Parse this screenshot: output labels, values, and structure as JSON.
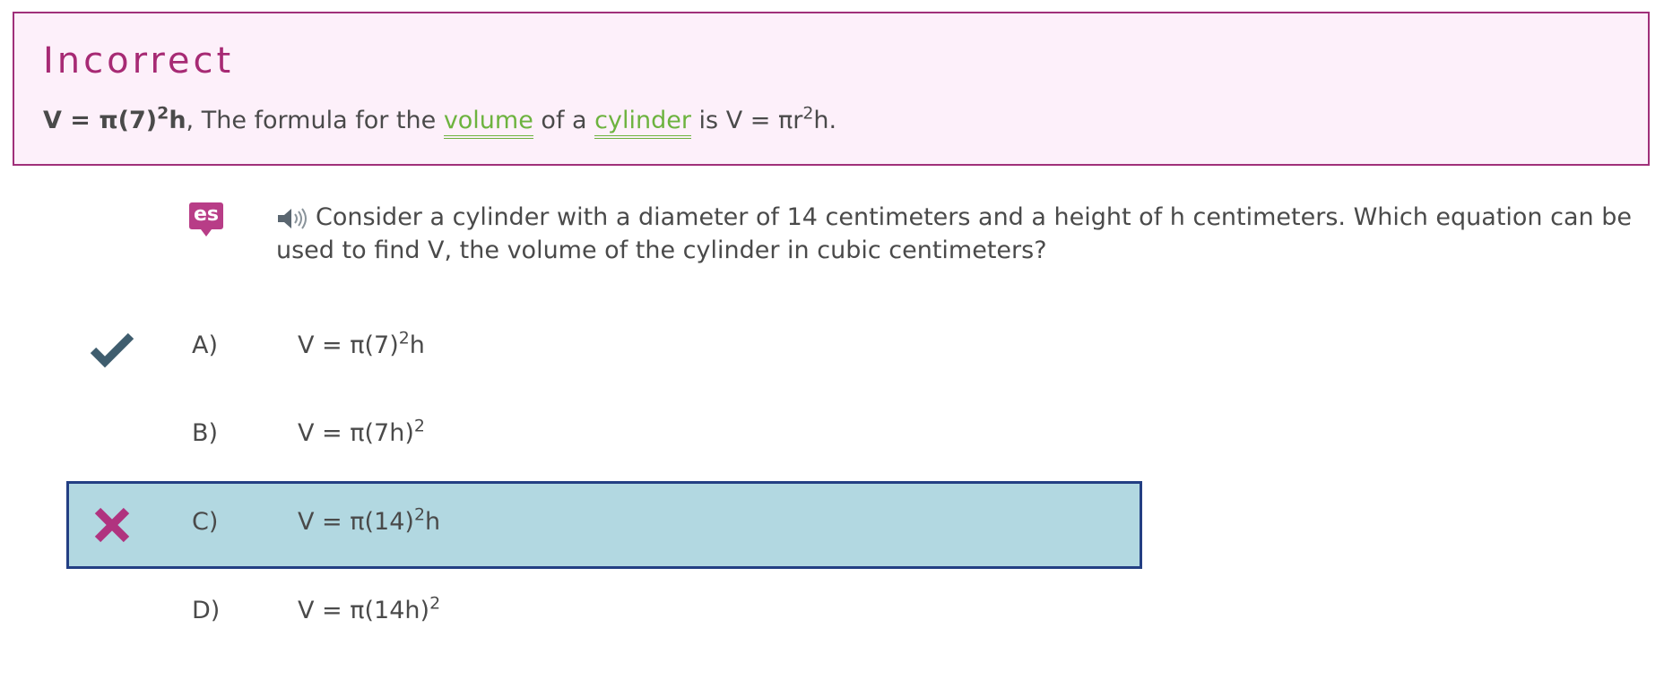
{
  "feedback": {
    "title": "Incorrect",
    "correct_answer": {
      "base": "V = π(7)",
      "exp": "2",
      "tail": "h"
    },
    "explanation_prefix": ", The formula for the ",
    "term_volume": "volume",
    "text_of_a": " of a ",
    "term_cylinder": "cylinder",
    "formula_prefix": " is V = πr",
    "formula_exp": "2",
    "formula_suffix": "h."
  },
  "question": {
    "language_icon_label": "es",
    "speaker_icon": "speaker-icon",
    "text": "Consider a cylinder with a diameter of 14 centimeters and a height of h centimeters. Which equation can be used to find V, the volume of the cylinder in cubic centimeters?"
  },
  "choices": [
    {
      "letter": "A)",
      "base": "V = π(7)",
      "exp": "2",
      "tail": "h",
      "status": "correct"
    },
    {
      "letter": "B)",
      "base": "V = π(7h)",
      "exp": "2",
      "tail": "",
      "status": "none"
    },
    {
      "letter": "C)",
      "base": "V = π(14)",
      "exp": "2",
      "tail": "h",
      "status": "incorrect-selected"
    },
    {
      "letter": "D)",
      "base": "V = π(14h)",
      "exp": "2",
      "tail": "",
      "status": "none"
    }
  ],
  "colors": {
    "feedback_bg": "#fdf0fa",
    "feedback_border": "#a0307a",
    "title": "#a72a74",
    "glossary_link": "#6db33f",
    "selected_bg": "#b2d8e1",
    "selected_border": "#233f83",
    "check_mark": "#3f5d6e",
    "x_mark": "#b0337f"
  }
}
